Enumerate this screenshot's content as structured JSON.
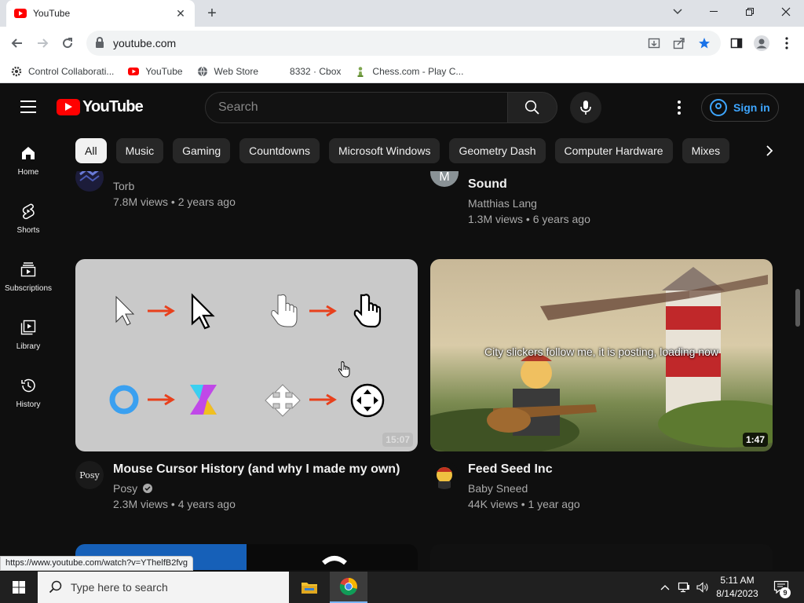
{
  "browser": {
    "tab_title": "YouTube",
    "url": "youtube.com",
    "new_tab": "+",
    "status_url": "https://www.youtube.com/watch?v=YThelfB2fvg"
  },
  "bookmarks": [
    {
      "label": "Control Collaborati..."
    },
    {
      "label": "YouTube"
    },
    {
      "label": "Web Store"
    },
    {
      "label": "8332 · Cbox"
    },
    {
      "label": "Chess.com - Play C..."
    }
  ],
  "masthead": {
    "logo_text": "YouTube",
    "search_placeholder": "Search",
    "sign_in": "Sign in"
  },
  "chips": [
    "All",
    "Music",
    "Gaming",
    "Countdowns",
    "Microsoft Windows",
    "Geometry Dash",
    "Computer Hardware",
    "Mixes"
  ],
  "sidebar": [
    {
      "label": "Home",
      "icon": "home-icon"
    },
    {
      "label": "Shorts",
      "icon": "shorts-icon"
    },
    {
      "label": "Subscriptions",
      "icon": "subscriptions-icon"
    },
    {
      "label": "Library",
      "icon": "library-icon"
    },
    {
      "label": "History",
      "icon": "history-icon"
    }
  ],
  "videos_top": [
    {
      "title": "",
      "channel": "Torb",
      "stats": "7.8M views • 2 years ago"
    },
    {
      "title": "Sound",
      "channel": "Matthias Lang",
      "stats": "1.3M views • 6 years ago",
      "avatar_letter": "M"
    }
  ],
  "videos": [
    {
      "title": "Mouse Cursor History (and why I made my own)",
      "channel": "Posy",
      "verified": true,
      "stats": "2.3M views • 4 years ago",
      "duration": "15:07",
      "avatar_text": "Posy"
    },
    {
      "title": "Feed Seed Inc",
      "channel": "Baby Sneed",
      "stats": "44K views • 1 year ago",
      "duration": "1:47",
      "caption": "City slickers follow me, it is posting, loading now"
    }
  ],
  "taskbar": {
    "search_placeholder": "Type here to search",
    "time": "5:11 AM",
    "date": "8/14/2023",
    "notification_count": "9"
  },
  "colors": {
    "yt_red": "#ff0000",
    "yt_bg": "#0f0f0f",
    "link_blue": "#3ea6ff",
    "chip_bg": "#272727"
  }
}
